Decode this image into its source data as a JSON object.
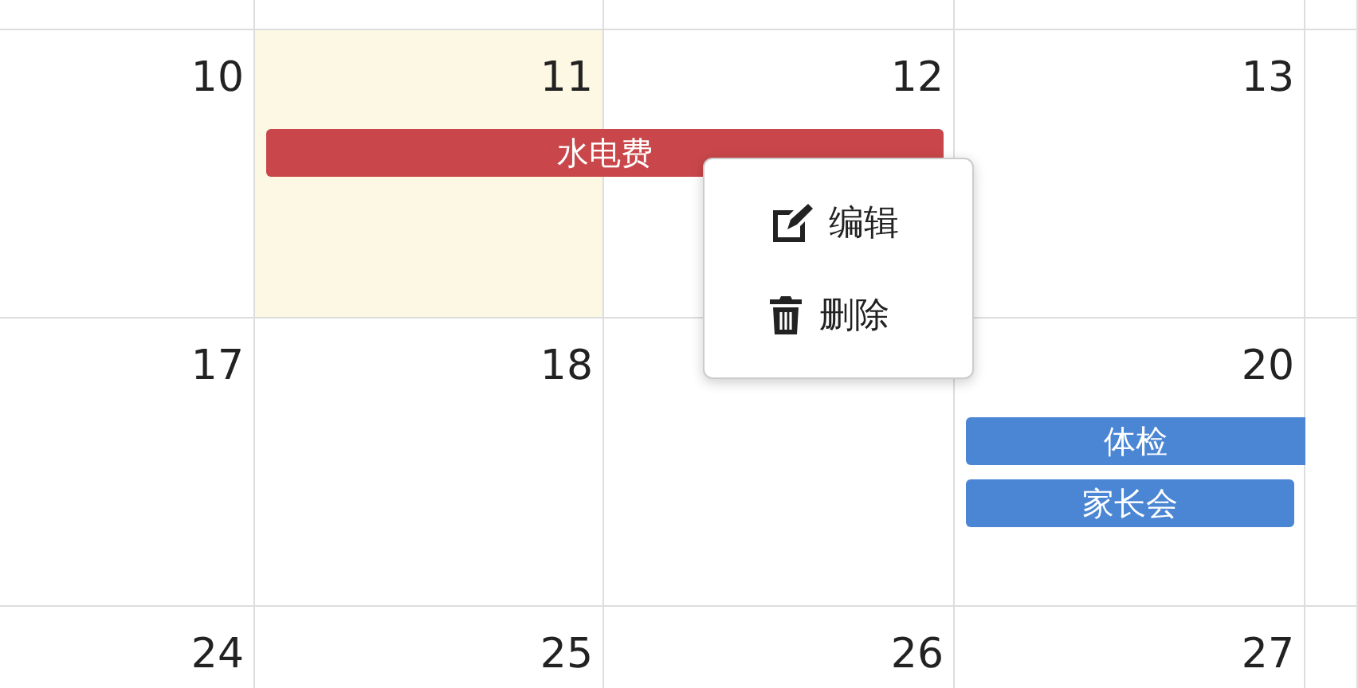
{
  "weeks": [
    {
      "days": [
        {
          "number": "10",
          "today": false
        },
        {
          "number": "11",
          "today": true,
          "events": [
            {
              "title": "水电费",
              "color": "#c9474a",
              "kind": "two-day"
            }
          ]
        },
        {
          "number": "12",
          "today": false
        },
        {
          "number": "13",
          "today": false
        }
      ]
    },
    {
      "days": [
        {
          "number": "17",
          "today": false
        },
        {
          "number": "18",
          "today": false
        },
        {
          "today": false
        },
        {
          "number": "20",
          "today": false,
          "events": [
            {
              "title": "体检",
              "color": "#4a86d4",
              "kind": "continues"
            },
            {
              "title": "家长会",
              "color": "#4a86d4",
              "kind": "one-day"
            }
          ]
        }
      ]
    },
    {
      "days": [
        {
          "number": "24",
          "today": false
        },
        {
          "number": "25",
          "today": false
        },
        {
          "number": "26",
          "today": false
        },
        {
          "number": "27",
          "today": false
        }
      ]
    }
  ],
  "context_menu": {
    "items": [
      {
        "kind": "edit",
        "label": "编辑"
      },
      {
        "kind": "delete",
        "label": "删除"
      }
    ]
  }
}
